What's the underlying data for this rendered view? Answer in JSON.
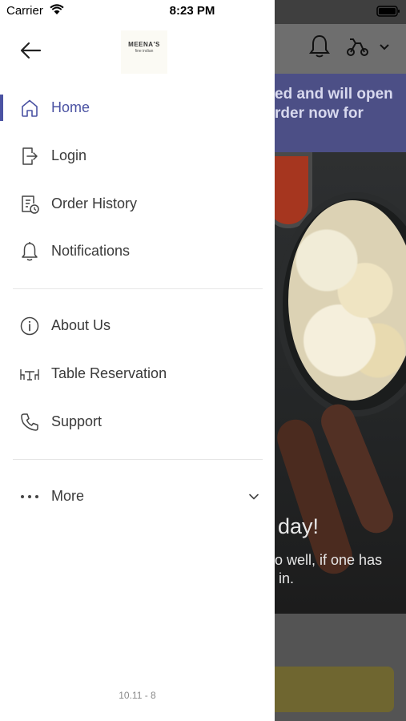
{
  "status_bar": {
    "carrier": "Carrier",
    "time": "8:23 PM"
  },
  "drawer": {
    "logo": {
      "name": "MEENA'S",
      "tagline": "fine indian"
    },
    "primary_items": [
      {
        "label": "Home",
        "icon": "home-icon",
        "active": true
      },
      {
        "label": "Login",
        "icon": "login-icon",
        "active": false
      },
      {
        "label": "Order History",
        "icon": "order-history-icon",
        "active": false
      },
      {
        "label": "Notifications",
        "icon": "bell-icon",
        "active": false
      }
    ],
    "secondary_items": [
      {
        "label": "About Us",
        "icon": "info-icon"
      },
      {
        "label": "Table Reservation",
        "icon": "table-reservation-icon"
      },
      {
        "label": "Support",
        "icon": "phone-icon"
      }
    ],
    "more": {
      "label": "More",
      "icon": "more-dots-icon",
      "expanded": false
    },
    "version": "10.11 - 8"
  },
  "background": {
    "banner_text": "ed and will open\nrder now for",
    "hero_title": "day!",
    "hero_subtitle": "o well, if one has\n in."
  },
  "colors": {
    "accent": "#4b53a3",
    "text": "#3a3a3a",
    "banner": "#4c4f86",
    "cta": "#6f6630"
  }
}
